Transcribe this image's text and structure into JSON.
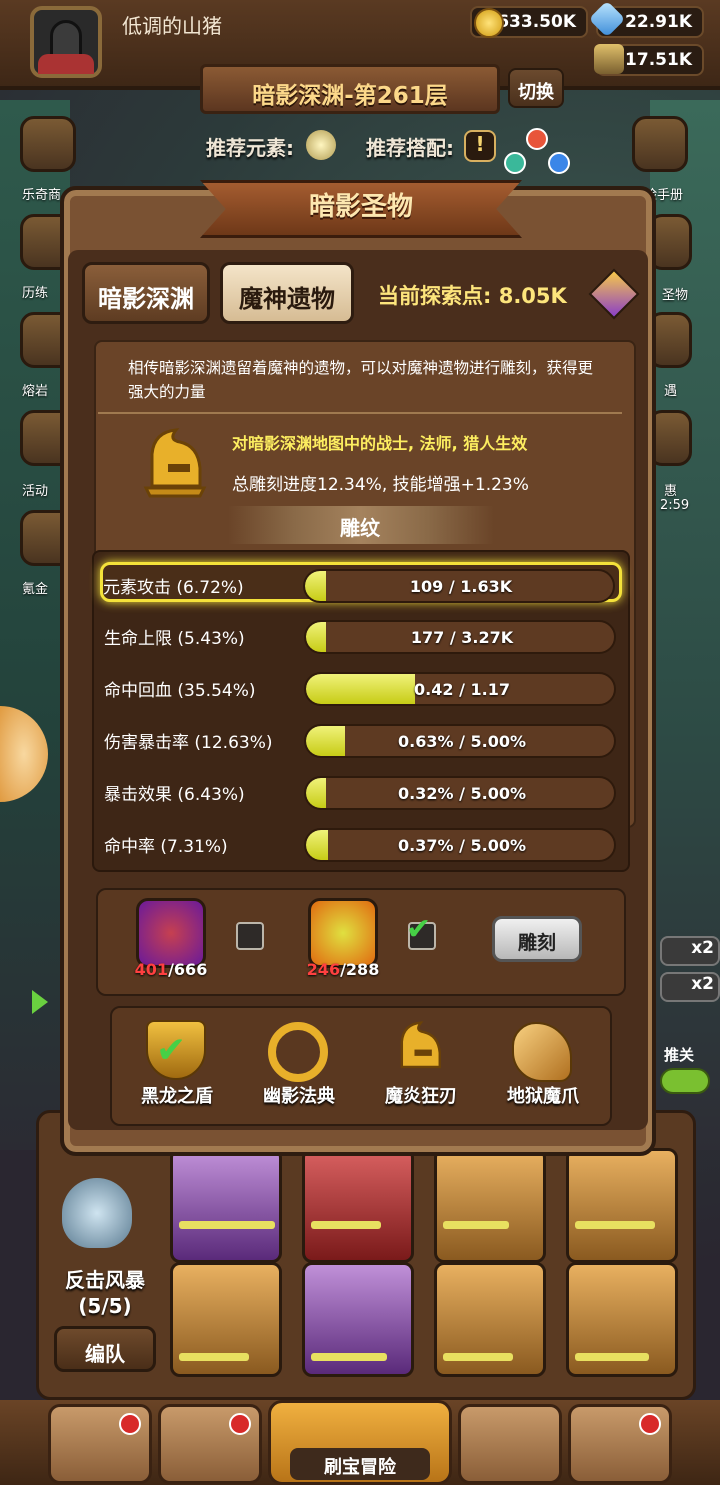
{
  "player": {
    "name": "低调的山猪"
  },
  "resources": {
    "gold": "633.50K",
    "crystal": "22.91K",
    "ore": "17.51K"
  },
  "stage": {
    "title": "暗影深渊-第261层",
    "switch_label": "切换"
  },
  "recommend": {
    "element_label": "推荐元素:",
    "combo_label": "推荐搭配:"
  },
  "side_left": [
    "乐奇商",
    "历练",
    "熔岩",
    "活动",
    "氪金"
  ],
  "side_right": [
    "险手册",
    "圣物",
    "遇",
    "惠",
    "2:59"
  ],
  "panel": {
    "title": "暗影圣物",
    "tabs": [
      "暗影深渊",
      "魔神遗物"
    ],
    "active_tab": 1,
    "explore_label": "当前探索点:",
    "explore_value": "8.05K",
    "description": "相传暗影深渊遗留着魔神的遗物，可以对魔神遗物进行雕刻，获得更强大的力量",
    "effect_target": "对暗影深渊地图中的战士, 法师, 猎人生效",
    "effect_total": "总雕刻进度12.34%, 技能增强+1.23%",
    "sub_header": "雕纹",
    "engravings": [
      {
        "label": "元素攻击 (6.72%)",
        "value": "109 / 1.63K",
        "progress": 0.067,
        "selected": true
      },
      {
        "label": "生命上限 (5.43%)",
        "value": "177 / 3.27K",
        "progress": 0.054,
        "selected": false
      },
      {
        "label": "命中回血 (35.54%)",
        "value": "0.42 / 1.17",
        "progress": 0.355,
        "selected": false
      },
      {
        "label": "伤害暴击率 (12.63%)",
        "value": "0.63% / 5.00%",
        "progress": 0.126,
        "selected": false
      },
      {
        "label": "暴击效果 (6.43%)",
        "value": "0.32% / 5.00%",
        "progress": 0.064,
        "selected": false
      },
      {
        "label": "命中率 (7.31%)",
        "value": "0.37% / 5.00%",
        "progress": 0.073,
        "selected": false
      }
    ],
    "materials": [
      {
        "have": "401",
        "need": "/666",
        "checked": false,
        "color": "#8a2ac8"
      },
      {
        "have": "246",
        "need": "/288",
        "checked": true,
        "color": "#f08a1a"
      }
    ],
    "carve_label": "雕刻",
    "relics": [
      {
        "name": "黑龙之盾",
        "icon": "shield-icon",
        "equipped": true
      },
      {
        "name": "幽影法典",
        "icon": "laurel-icon",
        "equipped": false
      },
      {
        "name": "魔炎狂刃",
        "icon": "helmet-icon",
        "equipped": false
      },
      {
        "name": "地狱魔爪",
        "icon": "dragon-icon",
        "equipped": false
      }
    ]
  },
  "team": {
    "name": "反击风暴",
    "count": "(5/5)",
    "edit_label": "编队"
  },
  "side_misc": {
    "x2a": "x2",
    "x2b": "x2",
    "label": "推关"
  },
  "nav": {
    "adventure_label": "刷宝冒险"
  },
  "colors": {
    "progress_fill": "#d6da22",
    "selected_border": "#f4e23a",
    "highlight_text": "#fdee60"
  }
}
